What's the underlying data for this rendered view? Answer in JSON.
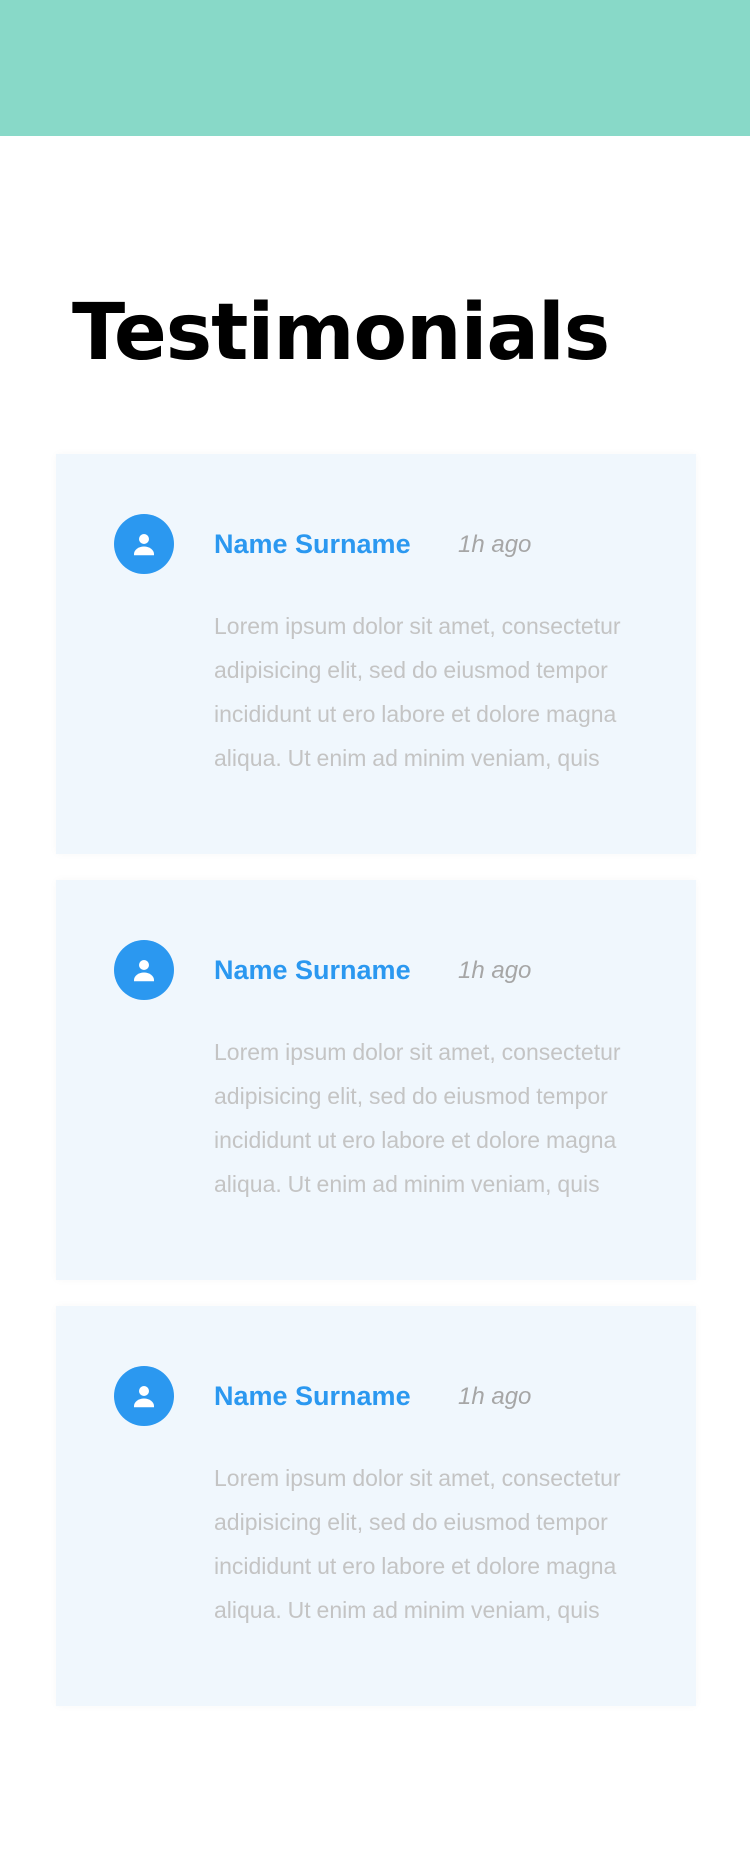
{
  "page": {
    "title": "Testimonials"
  },
  "colors": {
    "header": "#88d9c8",
    "card_background": "#f0f7fd",
    "accent": "#2b98f0",
    "muted_text": "#c4c4c4",
    "time_text": "#a6a6a6"
  },
  "testimonials": [
    {
      "avatar_icon": "person-icon",
      "name": "Name Surname",
      "time": "1h ago",
      "text": "Lorem ipsum dolor sit amet, consectetur adipisicing elit, sed do eiusmod tempor incididunt ut ero labore et dolore magna aliqua. Ut enim ad minim veniam, quis"
    },
    {
      "avatar_icon": "person-icon",
      "name": "Name Surname",
      "time": "1h ago",
      "text": "Lorem ipsum dolor sit amet, consectetur adipisicing elit, sed do eiusmod tempor incididunt ut ero labore et dolore magna aliqua. Ut enim ad minim veniam, quis"
    },
    {
      "avatar_icon": "person-icon",
      "name": "Name Surname",
      "time": "1h ago",
      "text": "Lorem ipsum dolor sit amet, consectetur adipisicing elit, sed do eiusmod tempor incididunt ut ero labore et dolore magna aliqua. Ut enim ad minim veniam, quis"
    }
  ]
}
